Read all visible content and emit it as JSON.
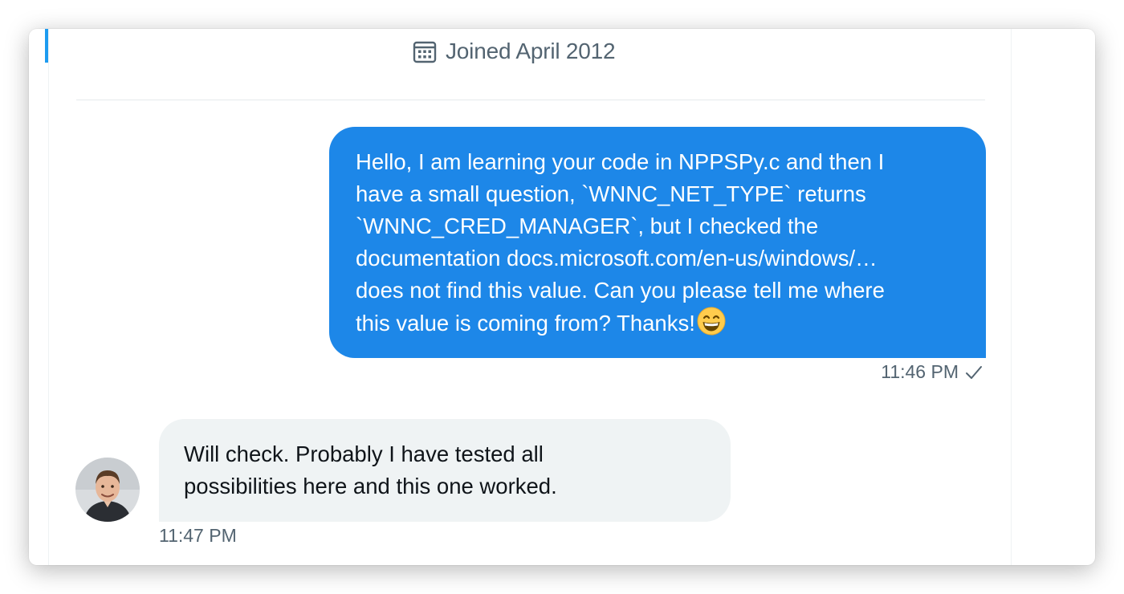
{
  "profile": {
    "joined_text": "Joined April 2012",
    "calendar_icon": "calendar-icon"
  },
  "messages": [
    {
      "direction": "outgoing",
      "lines": [
        "Hello, I am learning your code in NPPSPy.c and then I",
        "have a small question, `WNNC_NET_TYPE` returns",
        "`WNNC_CRED_MANAGER`, but I checked the",
        "documentation docs.microsoft.com/en-us/windows/…",
        "does not find this value. Can you please tell me where",
        "this value is coming from? Thanks!"
      ],
      "emoji": "grinning-face-with-smiling-eyes-emoji",
      "time": "11:46 PM",
      "status_icon": "checkmark-icon"
    },
    {
      "direction": "incoming",
      "lines": [
        "Will check. Probably I have tested all",
        "possibilities here and this one worked."
      ],
      "avatar_icon": "avatar",
      "time": "11:47 PM"
    }
  ],
  "colors": {
    "outgoing_bubble": "#1d87e8",
    "incoming_bubble": "#eff3f4",
    "accent": "#1d9bf0",
    "secondary_text": "#536471"
  }
}
